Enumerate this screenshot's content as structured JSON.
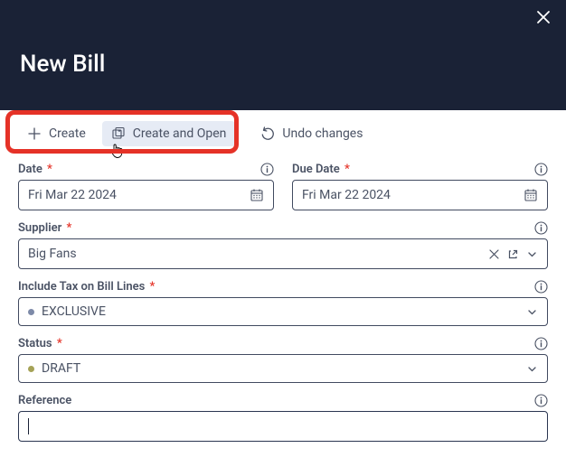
{
  "header": {
    "title": "New Bill"
  },
  "toolbar": {
    "create_label": "Create",
    "create_open_label": "Create and Open",
    "undo_label": "Undo changes"
  },
  "fields": {
    "date": {
      "label": "Date",
      "value": "Fri Mar 22 2024"
    },
    "due_date": {
      "label": "Due Date",
      "value": "Fri Mar 22 2024"
    },
    "supplier": {
      "label": "Supplier",
      "value": "Big Fans"
    },
    "tax": {
      "label": "Include Tax on Bill Lines",
      "value": "EXCLUSIVE"
    },
    "status": {
      "label": "Status",
      "value": "DRAFT"
    },
    "reference": {
      "label": "Reference",
      "value": ""
    }
  },
  "colors": {
    "header_bg": "#1a2236",
    "highlight": "#e53227",
    "hover_bg": "#e6ebf5"
  }
}
